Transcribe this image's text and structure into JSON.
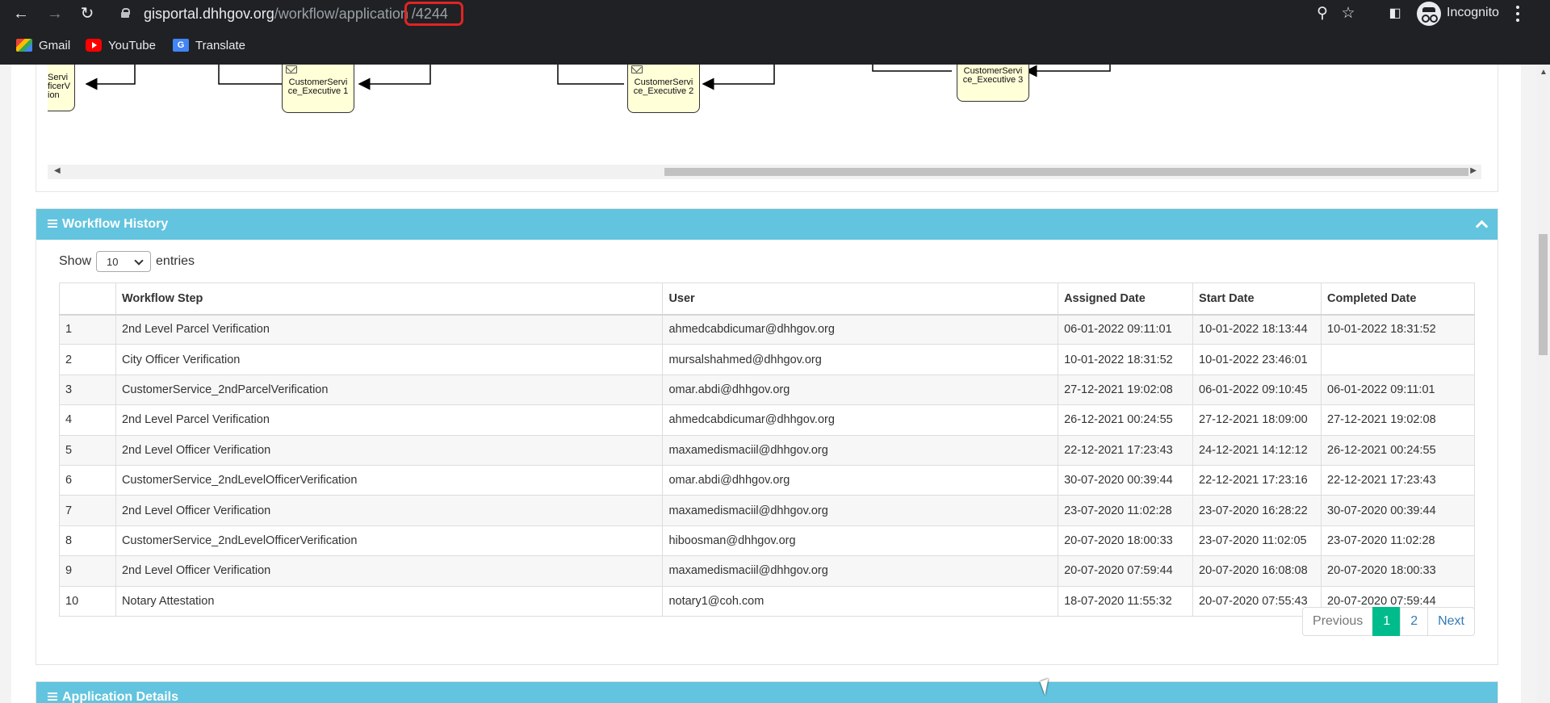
{
  "browser": {
    "url_host": "gisportal.dhhgov.org",
    "url_path": "/workflow/application",
    "url_highlight": "/4244",
    "incognito_label": "Incognito",
    "bookmarks": [
      {
        "label": "Gmail",
        "icon": "gmail-icon"
      },
      {
        "label": "YouTube",
        "icon": "youtube-icon"
      },
      {
        "label": "Translate",
        "icon": "translate-icon"
      }
    ]
  },
  "diagram": {
    "nodes": [
      {
        "label": "Servi ficerV ion"
      },
      {
        "label": "CustomerServi ce_Executive 1"
      },
      {
        "label": "CustomerServi ce_Executive 2"
      },
      {
        "label": "CustomerServi ce_Executive 3"
      }
    ]
  },
  "workflow_history": {
    "title": "Workflow History",
    "show_label": "Show",
    "entries_label": "entries",
    "page_size": "10",
    "columns": [
      "",
      "Workflow Step",
      "User",
      "Assigned Date",
      "Start Date",
      "Completed Date"
    ],
    "rows": [
      {
        "no": "1",
        "step": "2nd Level Parcel Verification",
        "user": "ahmedcabdicumar@dhhgov.org",
        "assigned": "06-01-2022 09:11:01",
        "start": "10-01-2022 18:13:44",
        "completed": "10-01-2022 18:31:52"
      },
      {
        "no": "2",
        "step": "City Officer Verification",
        "user": "mursalshahmed@dhhgov.org",
        "assigned": "10-01-2022 18:31:52",
        "start": "10-01-2022 23:46:01",
        "completed": ""
      },
      {
        "no": "3",
        "step": "CustomerService_2ndParcelVerification",
        "user": "omar.abdi@dhhgov.org",
        "assigned": "27-12-2021 19:02:08",
        "start": "06-01-2022 09:10:45",
        "completed": "06-01-2022 09:11:01"
      },
      {
        "no": "4",
        "step": "2nd Level Parcel Verification",
        "user": "ahmedcabdicumar@dhhgov.org",
        "assigned": "26-12-2021 00:24:55",
        "start": "27-12-2021 18:09:00",
        "completed": "27-12-2021 19:02:08"
      },
      {
        "no": "5",
        "step": "2nd Level Officer Verification",
        "user": "maxamedismaciil@dhhgov.org",
        "assigned": "22-12-2021 17:23:43",
        "start": "24-12-2021 14:12:12",
        "completed": "26-12-2021 00:24:55"
      },
      {
        "no": "6",
        "step": "CustomerService_2ndLevelOfficerVerification",
        "user": "omar.abdi@dhhgov.org",
        "assigned": "30-07-2020 00:39:44",
        "start": "22-12-2021 17:23:16",
        "completed": "22-12-2021 17:23:43"
      },
      {
        "no": "7",
        "step": "2nd Level Officer Verification",
        "user": "maxamedismaciil@dhhgov.org",
        "assigned": "23-07-2020 11:02:28",
        "start": "23-07-2020 16:28:22",
        "completed": "30-07-2020 00:39:44"
      },
      {
        "no": "8",
        "step": "CustomerService_2ndLevelOfficerVerification",
        "user": "hiboosman@dhhgov.org",
        "assigned": "20-07-2020 18:00:33",
        "start": "23-07-2020 11:02:05",
        "completed": "23-07-2020 11:02:28"
      },
      {
        "no": "9",
        "step": "2nd Level Officer Verification",
        "user": "maxamedismaciil@dhhgov.org",
        "assigned": "20-07-2020 07:59:44",
        "start": "20-07-2020 16:08:08",
        "completed": "20-07-2020 18:00:33"
      },
      {
        "no": "10",
        "step": "Notary Attestation",
        "user": "notary1@coh.com",
        "assigned": "18-07-2020 11:55:32",
        "start": "20-07-2020 07:55:43",
        "completed": "20-07-2020 07:59:44"
      }
    ],
    "pagination": {
      "previous": "Previous",
      "pages": [
        "1",
        "2"
      ],
      "active": "1",
      "next": "Next"
    }
  },
  "application_details": {
    "title": "Application Details"
  },
  "colors": {
    "header": "#62c4de",
    "active_page": "#00bc8c",
    "node_fill": "#ffffd8",
    "url_highlight": "#e02424"
  }
}
